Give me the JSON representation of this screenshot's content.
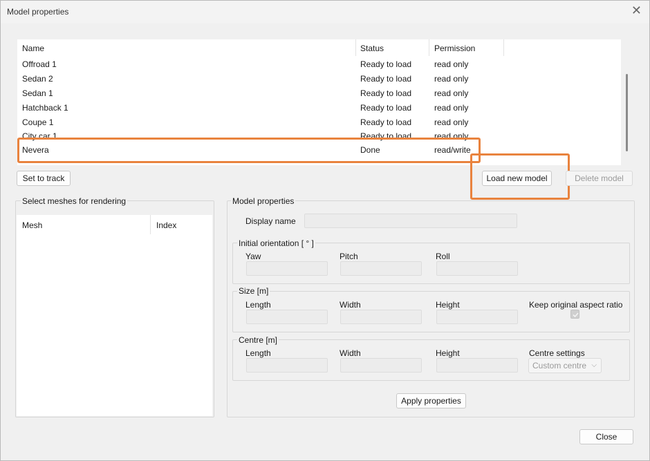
{
  "window": {
    "title": "Model properties",
    "close_glyph": "✕"
  },
  "models_table": {
    "columns": [
      "Name",
      "Status",
      "Permission"
    ],
    "rows": [
      {
        "name": "Offroad 1",
        "status": "Ready to load",
        "permission": "read only"
      },
      {
        "name": "Sedan 2",
        "status": "Ready to load",
        "permission": "read only"
      },
      {
        "name": "Sedan 1",
        "status": "Ready to load",
        "permission": "read only"
      },
      {
        "name": "Hatchback 1",
        "status": "Ready to load",
        "permission": "read only"
      },
      {
        "name": "Coupe 1",
        "status": "Ready to load",
        "permission": "read only"
      },
      {
        "name": "City car 1",
        "status": "Ready to load",
        "permission": "read only"
      },
      {
        "name": "Nevera",
        "status": "Done",
        "permission": "read/write"
      }
    ]
  },
  "buttons": {
    "set_to_track": "Set to track",
    "load_new_model": "Load new model",
    "delete_model": "Delete model",
    "apply_properties": "Apply properties",
    "close": "Close"
  },
  "meshes_group": {
    "title": "Select meshes for rendering",
    "columns": [
      "Mesh",
      "Index"
    ]
  },
  "model_properties": {
    "title": "Model properties",
    "display_name_label": "Display name",
    "orientation": {
      "title": "Initial orientation [ ° ]",
      "yaw": "Yaw",
      "pitch": "Pitch",
      "roll": "Roll"
    },
    "size": {
      "title": "Size [m]",
      "length": "Length",
      "width": "Width",
      "height": "Height",
      "keep_aspect": "Keep original aspect ratio"
    },
    "centre": {
      "title": "Centre [m]",
      "length": "Length",
      "width": "Width",
      "height": "Height",
      "settings_label": "Centre settings",
      "settings_value": "Custom centre"
    }
  },
  "colors": {
    "highlight": "#e9833e"
  }
}
